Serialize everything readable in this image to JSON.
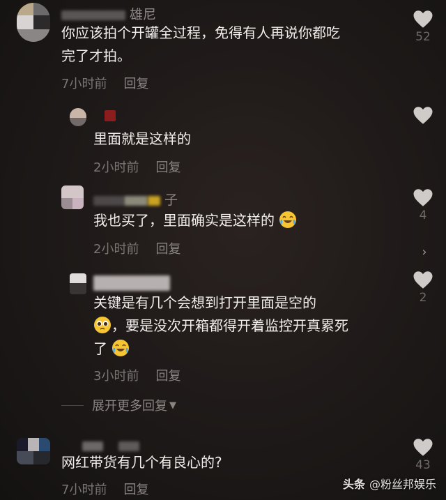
{
  "comments": [
    {
      "username_suffix": "雄尼",
      "text_lines": [
        "你应该拍个开罐全过程，免得有人再说你都吃",
        "完了才拍。"
      ],
      "time": "7小时前",
      "reply": "回复",
      "likes": "52"
    },
    {
      "username_suffix": "",
      "text_lines": [
        "里面就是这样的"
      ],
      "time": "2小时前",
      "reply": "回复",
      "likes": ""
    },
    {
      "username_suffix": "子",
      "text_lines": [
        "我也买了，里面确实是这样的"
      ],
      "time": "2小时前",
      "reply": "回复",
      "likes": "4"
    },
    {
      "username_suffix": "",
      "text_lines": [
        "关键是有几个会想到打开里面是空的",
        "，要是没次开箱都得开着监控开真累死",
        "了"
      ],
      "time": "3小时前",
      "reply": "回复",
      "likes": "2"
    },
    {
      "username_suffix": "",
      "text_lines": [
        "网红带货有几个有良心的?"
      ],
      "time": "7小时前",
      "reply": "回复",
      "likes": "43"
    }
  ],
  "expand_more": "展开更多回复",
  "side_arrow": "›",
  "watermark": {
    "brand": "头条",
    "account": "@粉丝邦娱乐"
  },
  "icons": {
    "like": "heart-icon",
    "laugh": "laughing-tears-emoji",
    "pleading": "pleading-face-emoji"
  },
  "colors": {
    "background": "#1c1818",
    "text": "#f1eeec",
    "meta": "#7a7674",
    "heart": "#cfcbc9"
  }
}
